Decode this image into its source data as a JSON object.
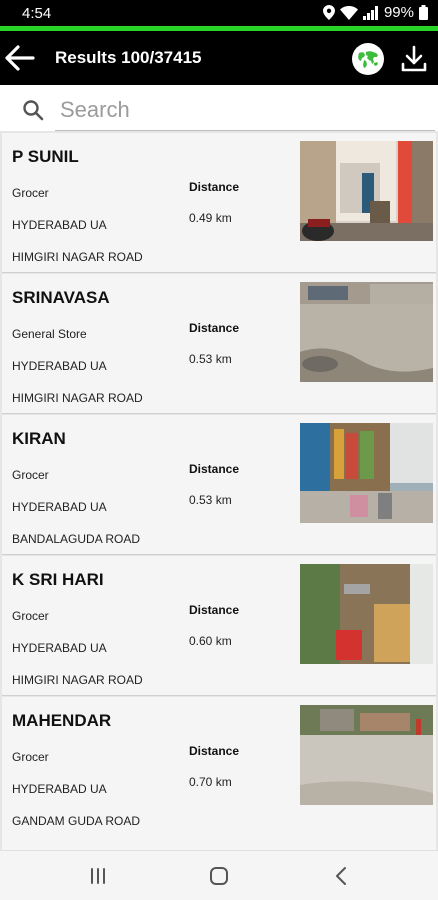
{
  "status_bar": {
    "time": "4:54",
    "battery": "99%"
  },
  "app_bar": {
    "title": "Results  100/37415"
  },
  "search": {
    "placeholder": "Search",
    "value": ""
  },
  "results": [
    {
      "name": "P SUNIL",
      "category": "Grocer",
      "city": "HYDERABAD UA",
      "road": "HIMGIRI NAGAR ROAD",
      "distance_label": "Distance",
      "distance": "0.49 km"
    },
    {
      "name": "SRINAVASA",
      "category": "General Store",
      "city": "HYDERABAD UA",
      "road": "HIMGIRI NAGAR ROAD",
      "distance_label": "Distance",
      "distance": "0.53 km"
    },
    {
      "name": "KIRAN",
      "category": "Grocer",
      "city": "HYDERABAD UA",
      "road": "BANDALAGUDA ROAD",
      "distance_label": "Distance",
      "distance": "0.53 km"
    },
    {
      "name": "K SRI HARI",
      "category": "Grocer",
      "city": "HYDERABAD UA",
      "road": "HIMGIRI NAGAR ROAD",
      "distance_label": "Distance",
      "distance": "0.60 km"
    },
    {
      "name": "MAHENDAR",
      "category": "Grocer",
      "city": "HYDERABAD UA",
      "road": "GANDAM GUDA ROAD",
      "distance_label": "Distance",
      "distance": "0.70 km"
    }
  ],
  "icons": {
    "back": "arrow-left-icon",
    "map": "world-map-icon",
    "download": "download-icon",
    "search": "search-icon",
    "recents": "recents-icon",
    "home": "home-icon",
    "nav_back": "chevron-left-icon"
  },
  "colors": {
    "accent": "#28d428",
    "app_bar": "#000000",
    "map_icon": "#3dbd3d"
  }
}
